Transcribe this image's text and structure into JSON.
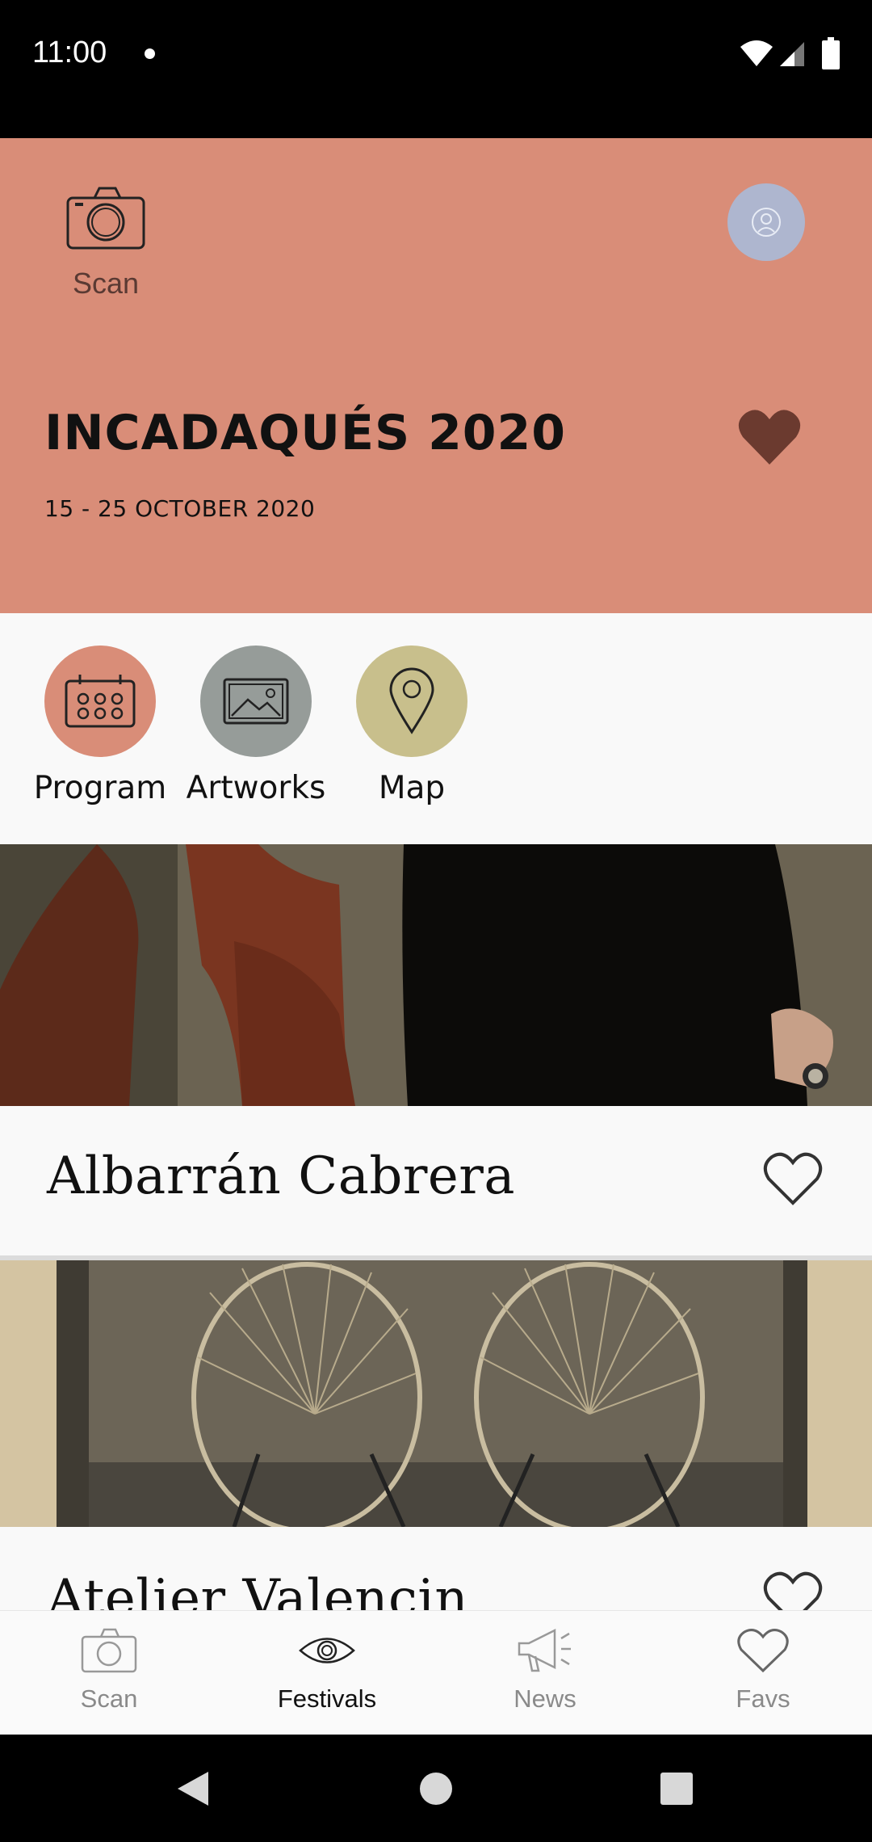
{
  "status_bar": {
    "time": "11:00"
  },
  "header": {
    "scan_label": "Scan",
    "festival_title": "INCADAQUÉS 2020",
    "festival_dates": "15 - 25 OCTOBER 2020",
    "accent_color": "#d98d78"
  },
  "quick_actions": [
    {
      "label": "Program",
      "icon": "calendar-icon",
      "color": "#d98d78"
    },
    {
      "label": "Artworks",
      "icon": "image-icon",
      "color": "#969c99"
    },
    {
      "label": "Map",
      "icon": "map-pin-icon",
      "color": "#c8bf8c"
    }
  ],
  "cards": [
    {
      "title": "Albarrán Cabrera",
      "favorited": false
    },
    {
      "title": "Atelier Valencin",
      "favorited": false
    }
  ],
  "bottom_nav": [
    {
      "label": "Scan",
      "icon": "camera-icon",
      "active": false
    },
    {
      "label": "Festivals",
      "icon": "eye-icon",
      "active": true
    },
    {
      "label": "News",
      "icon": "megaphone-icon",
      "active": false
    },
    {
      "label": "Favs",
      "icon": "heart-icon",
      "active": false
    }
  ]
}
